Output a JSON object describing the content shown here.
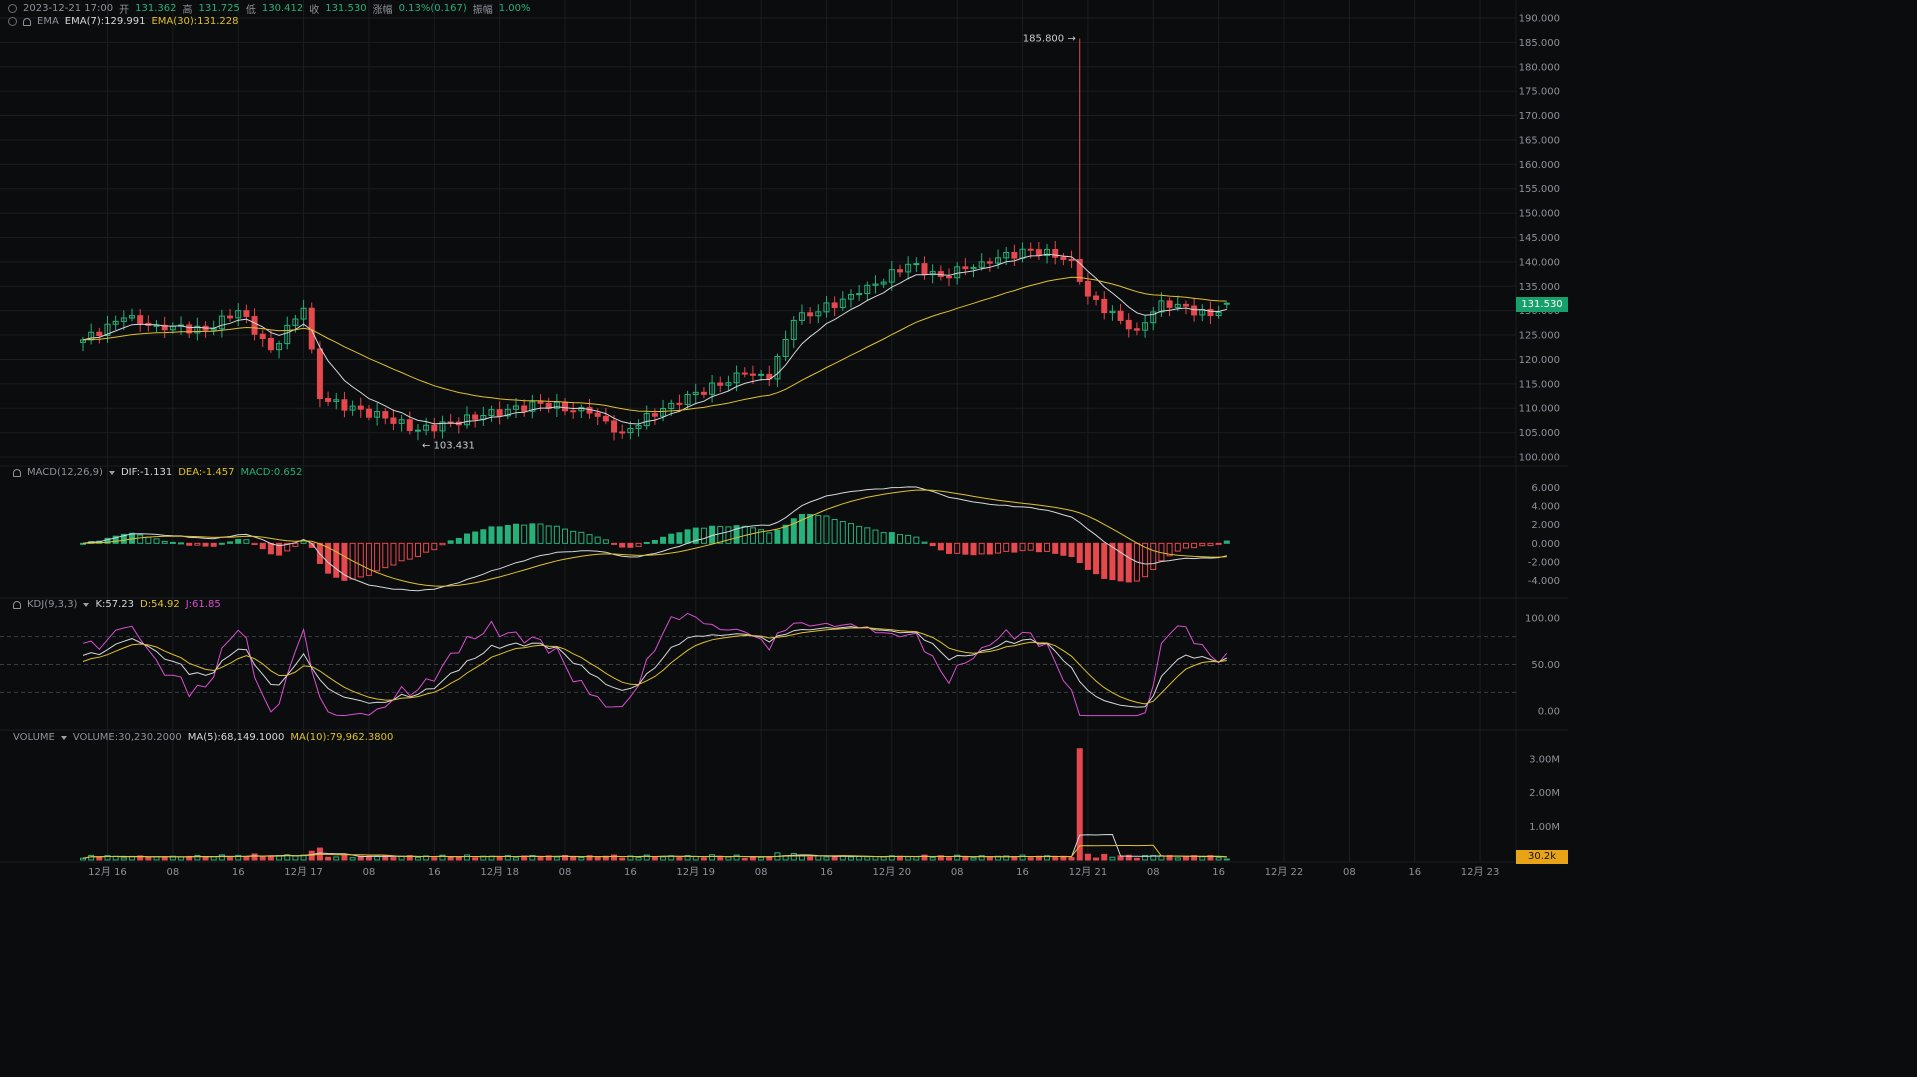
{
  "header": {
    "line1": "2023-12-21 17:00  开 131.362  高 131.725  低 130.412  收 131.530  涨幅 0.13%(0.167)  振幅 1.00%",
    "date": "2023-12-21 17:00",
    "open_label": "开",
    "open": "131.362",
    "high_label": "高",
    "high": "131.725",
    "low_label": "低",
    "low": "130.412",
    "close_label": "收",
    "close": "131.530",
    "change_label": "涨幅",
    "change": "0.13%(0.167)",
    "amp_label": "振幅",
    "amp": "1.00%"
  },
  "ema": {
    "name": "EMA",
    "ema7": "EMA(7):129.991",
    "ema30": "EMA(30):131.228"
  },
  "macd_header": {
    "name": "MACD(12,26,9)",
    "dif": "DIF:-1.131",
    "dea": "DEA:-1.457",
    "macd": "MACD:0.652"
  },
  "kdj_header": {
    "name": "KDJ(9,3,3)",
    "k": "K:57.23",
    "d": "D:54.92",
    "j": "J:61.85"
  },
  "volume_header": {
    "name": "VOLUME",
    "vol": "VOLUME:30,230.2000",
    "ma5": "MA(5):68,149.1000",
    "ma10": "MA(10):79,962.3800"
  },
  "price_tag": "131.530",
  "volume_tag": "30.2k",
  "max_label": "185.800",
  "min_label": "103.431",
  "colors": {
    "up": "#26b07a",
    "down": "#e5484d",
    "ema7": "#d5d7da",
    "ema30": "#e0c12b",
    "j": "#d94fd1",
    "grid": "#1b1d21"
  },
  "chart_data": [
    {
      "type": "candlestick",
      "name": "price",
      "x_ticks": [
        "12月 16",
        "08",
        "16",
        "12月 17",
        "08",
        "16",
        "12月 18",
        "08",
        "16",
        "12月 19",
        "08",
        "16",
        "12月 20",
        "08",
        "16",
        "12月 21",
        "08",
        "16",
        "12月 22",
        "08",
        "16",
        "12月 23"
      ],
      "y_ticks": [
        "190.000",
        "185.000",
        "180.000",
        "175.000",
        "170.000",
        "165.000",
        "160.000",
        "155.000",
        "150.000",
        "145.000",
        "140.000",
        "135.000",
        "130.000",
        "125.000",
        "120.000",
        "115.000",
        "110.000",
        "105.000",
        "100.000"
      ],
      "ylim": [
        100,
        190
      ],
      "interval": "1h",
      "start": "2023-12-15 21:00",
      "key_points": [
        {
          "t": "2023-12-15 21:00",
          "close": 124.0
        },
        {
          "t": "2023-12-16 02:00",
          "close": 128.5
        },
        {
          "t": "2023-12-16 06:00",
          "close": 127.0
        },
        {
          "t": "2023-12-16 12:00",
          "close": 126.0
        },
        {
          "t": "2023-12-16 16:00",
          "close": 130.0
        },
        {
          "t": "2023-12-16 20:00",
          "close": 122.0
        },
        {
          "t": "2023-12-17 00:00",
          "close": 130.5
        },
        {
          "t": "2023-12-17 02:00",
          "close": 112.0
        },
        {
          "t": "2023-12-17 10:00",
          "close": 108.0
        },
        {
          "t": "2023-12-17 14:00",
          "close": 105.5
        },
        {
          "t": "2023-12-17 22:00",
          "close": 108.5
        },
        {
          "t": "2023-12-18 05:00",
          "close": 111.0
        },
        {
          "t": "2023-12-18 11:00",
          "close": 109.0
        },
        {
          "t": "2023-12-18 15:00",
          "close": 105.0
        },
        {
          "t": "2023-12-18 21:00",
          "close": 111.0
        },
        {
          "t": "2023-12-19 06:00",
          "close": 117.0
        },
        {
          "t": "2023-12-19 09:00",
          "close": 116.0
        },
        {
          "t": "2023-12-19 12:00",
          "close": 128.0
        },
        {
          "t": "2023-12-19 20:00",
          "close": 133.5
        },
        {
          "t": "2023-12-20 02:00",
          "close": 139.5
        },
        {
          "t": "2023-12-20 06:00",
          "close": 137.0
        },
        {
          "t": "2023-12-20 11:00",
          "close": 140.0
        },
        {
          "t": "2023-12-20 17:00",
          "close": 142.5
        },
        {
          "t": "2023-12-20 22:00",
          "close": 140.5
        },
        {
          "t": "2023-12-21 00:00",
          "close": 133.0
        },
        {
          "t": "2023-12-21 04:00",
          "close": 128.0
        },
        {
          "t": "2023-12-21 06:00",
          "close": 126.0
        },
        {
          "t": "2023-12-21 09:00",
          "close": 132.0
        },
        {
          "t": "2023-12-21 15:00",
          "close": 129.0
        },
        {
          "t": "2023-12-21 17:00",
          "close": 131.53
        }
      ],
      "max": {
        "t": "2023-12-20 23:00",
        "value": 185.8
      },
      "min": {
        "t": "2023-12-17 14:00",
        "value": 103.431
      },
      "last": {
        "open": 131.362,
        "high": 131.725,
        "low": 130.412,
        "close": 131.53
      },
      "overlays": [
        "EMA(7)",
        "EMA(30)"
      ]
    },
    {
      "type": "bar",
      "name": "MACD(12,26,9)",
      "y_ticks": [
        "6.000",
        "4.000",
        "2.000",
        "0.000",
        "-2.000",
        "-4.000"
      ],
      "ylim": [
        -5,
        7
      ],
      "lines": [
        "DIF",
        "DEA"
      ],
      "last": {
        "dif": -1.131,
        "dea": -1.457,
        "macd": 0.652
      }
    },
    {
      "type": "line",
      "name": "KDJ(9,3,3)",
      "y_ticks": [
        "100.00",
        "50.00",
        "0.00"
      ],
      "ylim": [
        -5,
        110
      ],
      "reference_lines": [
        80,
        50,
        20
      ],
      "last": {
        "k": 57.23,
        "d": 54.92,
        "j": 61.85
      }
    },
    {
      "type": "bar",
      "name": "VOLUME",
      "y_ticks": [
        "3.00M",
        "2.00M",
        "1.00M"
      ],
      "ylim": [
        0,
        3500000
      ],
      "max": {
        "t": "2023-12-20 23:00",
        "value": 3300000
      },
      "last": {
        "volume": 30230.2,
        "ma5": 68149.1,
        "ma10": 79962.38
      }
    }
  ]
}
